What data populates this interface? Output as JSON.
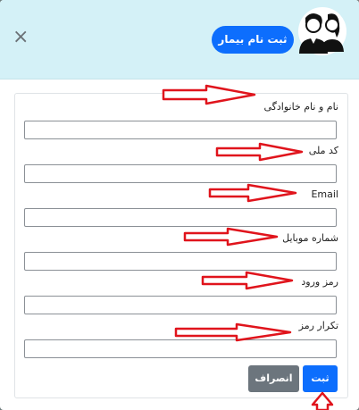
{
  "modal": {
    "title": "ثبت نام بیمار",
    "close_symbol": "×"
  },
  "form": {
    "fields": [
      {
        "label": "نام و نام خانوادگی",
        "value": ""
      },
      {
        "label": "کد ملی",
        "value": ""
      },
      {
        "label": "Email",
        "value": ""
      },
      {
        "label": "شماره موبایل",
        "value": ""
      },
      {
        "label": "رمز ورود",
        "value": ""
      },
      {
        "label": "تکرار رمز",
        "value": ""
      }
    ],
    "submit_label": "ثبت",
    "cancel_label": "انصراف"
  },
  "icons": {
    "avatar": "user-couple-icon",
    "close": "close-icon",
    "annotation": "red-arrow-icon"
  },
  "colors": {
    "header_bg": "#d4f1f7",
    "primary": "#0d6efd",
    "secondary": "#6c757d",
    "annotation": "#e0141c"
  }
}
